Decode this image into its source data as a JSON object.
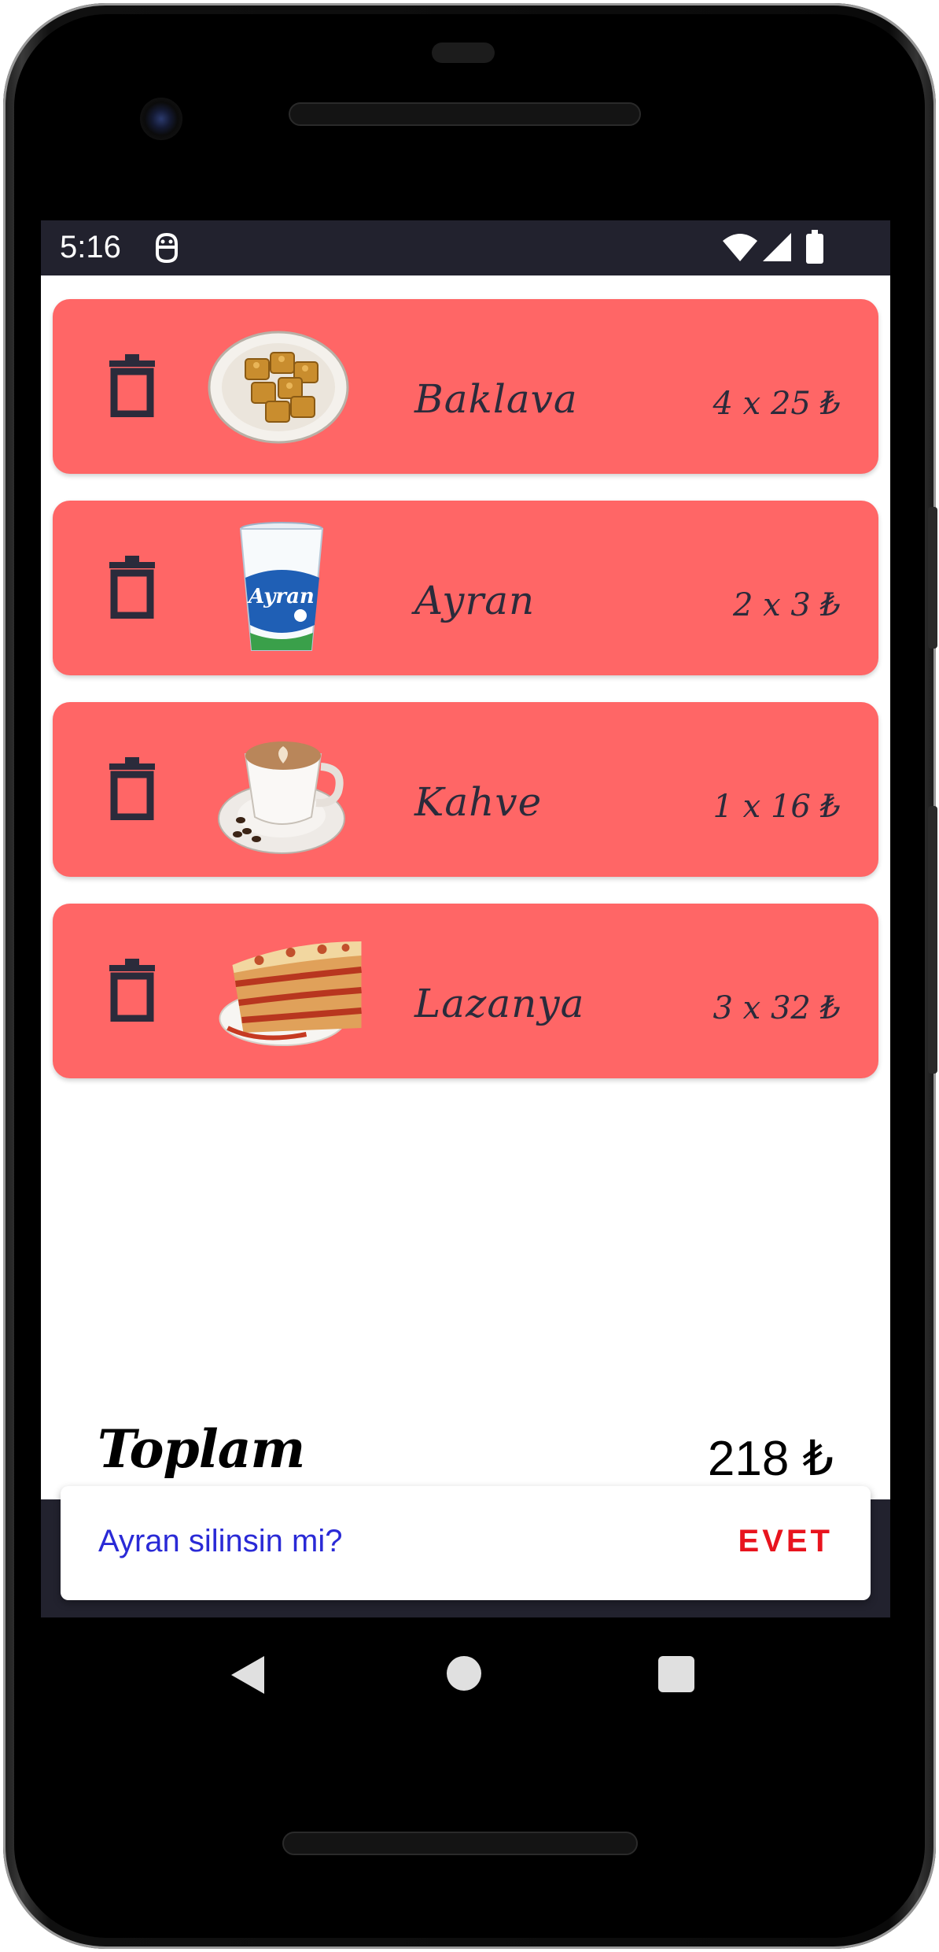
{
  "status_bar": {
    "time": "5:16",
    "icons": [
      "android-debug-icon",
      "wifi-icon",
      "cell-signal-icon",
      "battery-icon"
    ]
  },
  "cart": {
    "items": [
      {
        "name": "Baklava",
        "qty_price": "4 x 25 ₺",
        "image": "baklava-image"
      },
      {
        "name": "Ayran",
        "qty_price": "2 x 3 ₺",
        "image": "ayran-cup-image"
      },
      {
        "name": "Kahve",
        "qty_price": "1 x 16 ₺",
        "image": "coffee-cup-image"
      },
      {
        "name": "Lazanya",
        "qty_price": "3 x 32 ₺",
        "image": "lasagna-image"
      }
    ],
    "delete_icon": "trash-icon",
    "card_color": "#ff6666"
  },
  "total": {
    "label": "Toplam",
    "value": "218 ₺"
  },
  "snackbar": {
    "message": "Ayran silinsin mi?",
    "action": "EVET",
    "message_color": "#2a2ad6",
    "action_color": "#e8141e"
  },
  "nav": {
    "buttons": [
      "back-icon",
      "home-icon",
      "recents-icon"
    ]
  }
}
